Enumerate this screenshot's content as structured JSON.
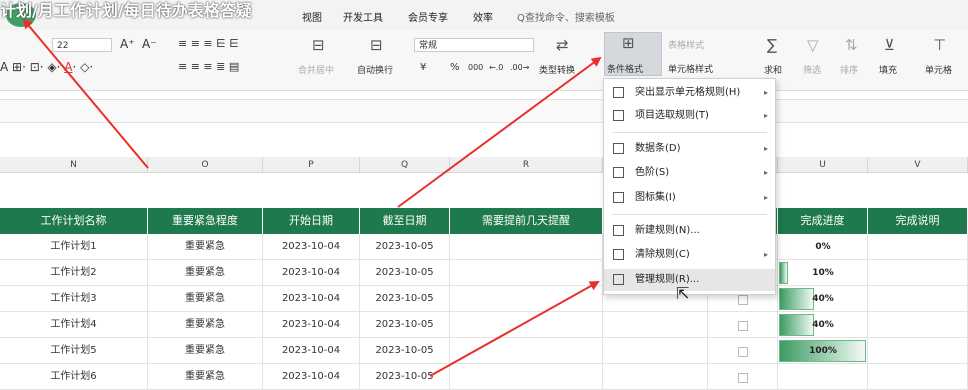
{
  "title_overlay": "计划/月工作计划/每日待办表格答疑",
  "menu": {
    "tabs": [
      "视图",
      "开发工具",
      "会员专享",
      "效率"
    ],
    "search": "Q查找命令、搜索模板"
  },
  "ribbon": {
    "font_size": "22",
    "font_btns": [
      "A⁺",
      "A⁻"
    ],
    "merge_label": "合并居中",
    "wrap_label": "自动换行",
    "number_format": "常规",
    "currency": "¥",
    "percent": "%",
    "thousands": "000",
    "dec_inc": "←.0",
    "dec_dec": ".00→",
    "type_convert": "类型转换",
    "cond_format": "条件格式",
    "table_style": "表格样式",
    "cell_style": "单元格样式",
    "sum": "求和",
    "filter": "筛选",
    "sort": "排序",
    "fill": "填充",
    "cell": "单元格"
  },
  "columns": [
    "N",
    "O",
    "P",
    "Q",
    "R",
    "U",
    "V"
  ],
  "table": {
    "headers": [
      "工作计划名称",
      "重要紧急程度",
      "开始日期",
      "截至日期",
      "需要提前几天提醒",
      "完成进度",
      "完成说明"
    ],
    "rows": [
      {
        "name": "工作计划1",
        "priority": "重要紧急",
        "start": "2023-10-04",
        "end": "2023-10-05",
        "progress": "0%",
        "progress_value": 0
      },
      {
        "name": "工作计划2",
        "priority": "重要紧急",
        "start": "2023-10-04",
        "end": "2023-10-05",
        "progress": "10%",
        "progress_value": 0.1
      },
      {
        "name": "工作计划3",
        "priority": "重要紧急",
        "start": "2023-10-04",
        "end": "2023-10-05",
        "progress": "40%",
        "progress_value": 0.4
      },
      {
        "name": "工作计划4",
        "priority": "重要紧急",
        "start": "2023-10-04",
        "end": "2023-10-05",
        "progress": "40%",
        "progress_value": 0.4
      },
      {
        "name": "工作计划5",
        "priority": "重要紧急",
        "start": "2023-10-04",
        "end": "2023-10-05",
        "progress": "100%",
        "progress_value": 1
      },
      {
        "name": "工作计划6",
        "priority": "重要紧急",
        "start": "2023-10-04",
        "end": "2023-10-05",
        "progress": "",
        "progress_value": null
      }
    ]
  },
  "dropdown": {
    "items": [
      {
        "label": "突出显示单元格规则(H)",
        "submenu": true
      },
      {
        "label": "项目选取规则(T)",
        "submenu": true
      },
      {
        "label": "数据条(D)",
        "submenu": true
      },
      {
        "label": "色阶(S)",
        "submenu": true
      },
      {
        "label": "图标集(I)",
        "submenu": true
      },
      {
        "label": "新建规则(N)...",
        "submenu": false
      },
      {
        "label": "清除规则(C)",
        "submenu": true
      },
      {
        "label": "管理规则(R)...",
        "submenu": false,
        "highlighted": true
      }
    ]
  },
  "colors": {
    "header_green": "#1e7a4c",
    "annotation_red": "#e8302a",
    "databar_green": "#3c9b63"
  }
}
